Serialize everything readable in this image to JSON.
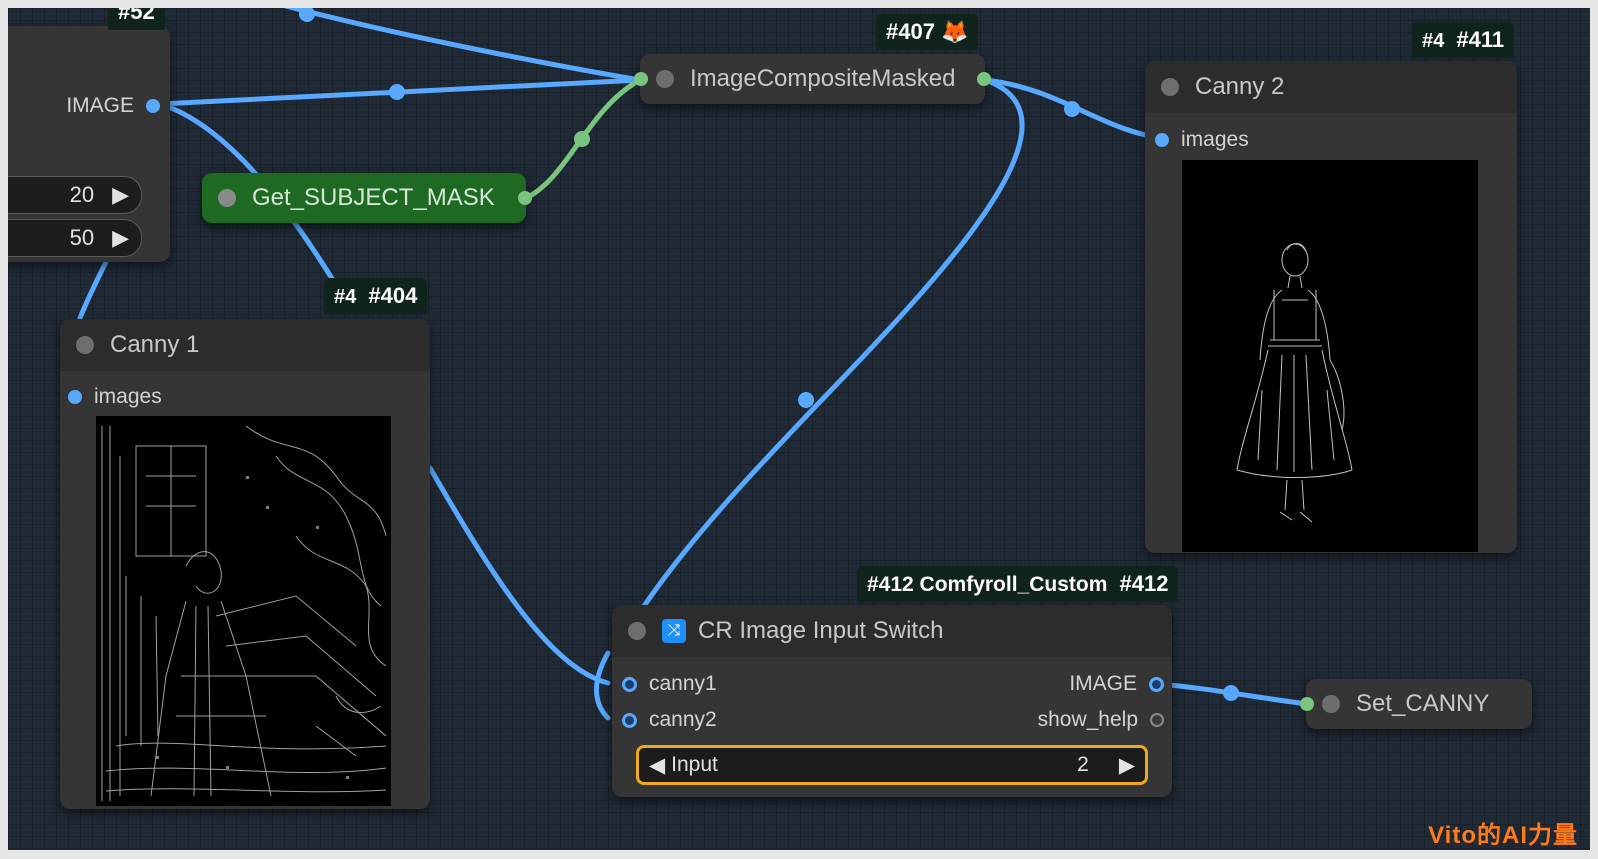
{
  "nodes": {
    "controller": {
      "badge_text": "#52",
      "output_label": "IMAGE",
      "values": [
        "20",
        "50"
      ]
    },
    "get_mask": {
      "title": "Get_SUBJECT_MASK"
    },
    "composite": {
      "badge_text": "#407",
      "title": "ImageCompositeMasked"
    },
    "canny1": {
      "badge_prefix": "#4",
      "badge_text": "#404",
      "title": "Canny 1",
      "input_label": "images"
    },
    "canny2": {
      "badge_prefix": "#4",
      "badge_text": "#411",
      "title": "Canny 2",
      "input_label": "images"
    },
    "switch": {
      "badge_text": "#412 Comfyroll_Custom",
      "badge_suffix": "#412",
      "title": "CR Image Input Switch",
      "inputs": [
        "canny1",
        "canny2"
      ],
      "outputs": [
        "IMAGE",
        "show_help"
      ],
      "widget_label": "Input",
      "widget_value": "2"
    },
    "set_canny": {
      "title": "Set_CANNY"
    }
  },
  "watermark": "Vito的AI力量",
  "colors": {
    "image_wire": "#58a8ff",
    "mask_wire": "#7bc47f",
    "canvas": "#1f2a36",
    "node": "#353535"
  }
}
